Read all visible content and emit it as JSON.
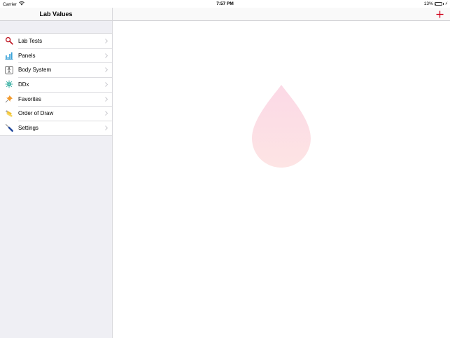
{
  "status_bar": {
    "carrier": "Carrier",
    "time": "7:57 PM",
    "battery": "13%",
    "battery_level": 0.13
  },
  "sidebar": {
    "title": "Lab Values",
    "items": [
      {
        "label": "Lab Tests",
        "icon": "magnifier-icon"
      },
      {
        "label": "Panels",
        "icon": "bar-chart-icon"
      },
      {
        "label": "Body System",
        "icon": "body-figure-icon"
      },
      {
        "label": "DDx",
        "icon": "virus-icon"
      },
      {
        "label": "Favorites",
        "icon": "pushpin-icon"
      },
      {
        "label": "Order of Draw",
        "icon": "test-tubes-icon"
      },
      {
        "label": "Settings",
        "icon": "screwdriver-icon"
      }
    ]
  },
  "detail": {
    "add_icon": "plus-icon",
    "placeholder_icon": "blood-drop-icon"
  },
  "colors": {
    "accent": "#d0021b",
    "sidebar_bg": "#efeff4",
    "drop_top": "#fcd9e6",
    "drop_bottom": "#fde4e4"
  }
}
